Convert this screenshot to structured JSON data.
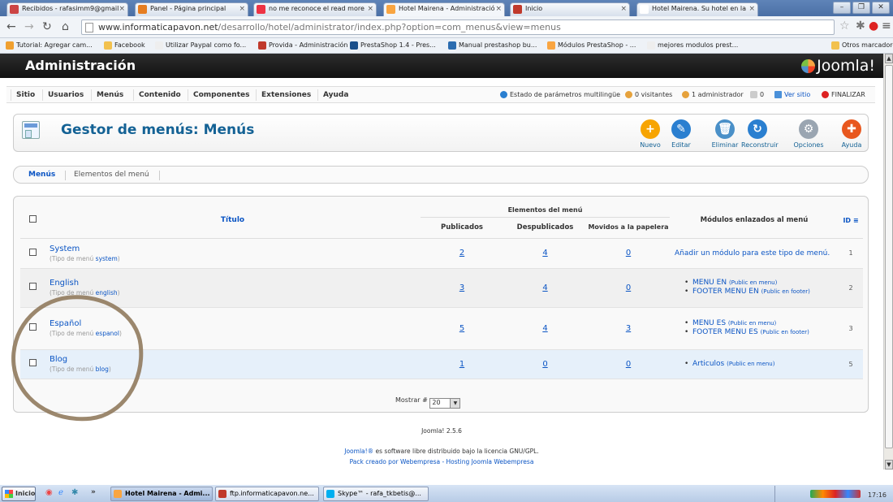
{
  "browser": {
    "tabs": [
      {
        "label": "Recibidos - rafasimm9@gmail",
        "color": "#c44"
      },
      {
        "label": "Panel - Página principal",
        "color": "#e67e22"
      },
      {
        "label": "no me reconoce el read more",
        "color": "#e34"
      },
      {
        "label": "Hotel Mairena - Administració",
        "color": "#f9a541"
      },
      {
        "label": "Inicio",
        "color": "#c0392b"
      },
      {
        "label": "Hotel Mairena. Su hotel en la",
        "color": "#fff"
      }
    ],
    "window_buttons": [
      "–",
      "❐",
      "✕"
    ],
    "url_host": "www.informaticapavon.net",
    "url_path": "/desarrollo/hotel/administrator/index.php?option=com_menus&view=menus",
    "bookmarks": [
      {
        "label": "Tutorial: Agregar cam...",
        "color": "#f0a030"
      },
      {
        "label": "Facebook",
        "color": "#f2c14e"
      },
      {
        "label": "Utilizar Paypal como fo...",
        "color": "#eee"
      },
      {
        "label": "Provida - Administración",
        "color": "#c0392b"
      },
      {
        "label": "PrestaShop 1.4 - Pres...",
        "color": "#1b4f8a"
      },
      {
        "label": "Manual prestashop bu...",
        "color": "#2b6cb0"
      },
      {
        "label": "Módulos PrestaShop - ...",
        "color": "#f9a541"
      },
      {
        "label": "mejores modulos prest...",
        "color": "#eee"
      }
    ],
    "other_bookmarks": "Otros marcadores"
  },
  "admin": {
    "title": "Administración",
    "logo": "Joomla!",
    "menu": [
      "Sitio",
      "Usuarios",
      "Menús",
      "Contenido",
      "Componentes",
      "Extensiones",
      "Ayuda"
    ],
    "status": {
      "multilingual": "Estado de parámetros multilingüe",
      "visitors": "0 visitantes",
      "admins": "1 administrador",
      "messages": "0",
      "view_site": "Ver sitio",
      "logout": "FINALIZAR"
    },
    "page_title": "Gestor de menús: Menús",
    "toolbar": [
      {
        "label": "Nuevo",
        "icon": "+",
        "color": "#f7a400"
      },
      {
        "label": "Editar",
        "icon": "✎",
        "color": "#2a7fd0"
      },
      {
        "label": "Eliminar",
        "icon": "🗑",
        "color": "#4a90c8"
      },
      {
        "label": "Reconstruir",
        "icon": "↻",
        "color": "#2a7fd0"
      },
      {
        "label": "Opciones",
        "icon": "⚙",
        "color": "#9aa5b1"
      },
      {
        "label": "Ayuda",
        "icon": "✚",
        "color": "#e8571e"
      }
    ],
    "subtabs": [
      "Menús",
      "Elementos del menú"
    ],
    "table": {
      "h_title": "Título",
      "h_group": "Elementos del menú",
      "h_pub": "Publicados",
      "h_unpub": "Despublicados",
      "h_trash": "Movidos a la papelera",
      "h_modules": "Módulos enlazados al menú",
      "h_id": "ID",
      "type_prefix": "(Tipo de menú",
      "rows": [
        {
          "title": "System",
          "type": "system",
          "pub": "2",
          "unpub": "4",
          "trash": "0",
          "modules_text": "Añadir un módulo para este tipo de menú.",
          "modules": [],
          "id": "1"
        },
        {
          "title": "English",
          "type": "english",
          "pub": "3",
          "unpub": "4",
          "trash": "0",
          "modules_text": "",
          "modules": [
            {
              "name": "MENU EN",
              "note": "(Public en menu)"
            },
            {
              "name": "FOOTER MENU EN",
              "note": "(Public en footer)"
            }
          ],
          "id": "2"
        },
        {
          "title": "Español",
          "type": "espanol",
          "pub": "5",
          "unpub": "4",
          "trash": "3",
          "modules_text": "",
          "modules": [
            {
              "name": "MENU ES",
              "note": "(Public en menu)"
            },
            {
              "name": "FOOTER MENU ES",
              "note": "(Public en footer)"
            }
          ],
          "id": "3"
        },
        {
          "title": "Blog",
          "type": "blog",
          "pub": "1",
          "unpub": "0",
          "trash": "0",
          "modules_text": "",
          "modules": [
            {
              "name": "Articulos",
              "note": "(Public en menu)"
            }
          ],
          "id": "5"
        }
      ]
    },
    "show_label": "Mostrar #",
    "show_value": "20",
    "footer": {
      "version": "Joomla! 2.5.6",
      "license_link": "Joomla!®",
      "license_text": "es software libre distribuido bajo la licencia GNU/GPL.",
      "pack": "Pack creado por Webempresa - Hosting Joomla Webempresa"
    }
  },
  "taskbar": {
    "start": "Inicio",
    "items": [
      {
        "label": "Hotel Mairena - Admi...",
        "color": "#f9a541"
      },
      {
        "label": "ftp.informaticapavon.ne...",
        "color": "#c0392b"
      },
      {
        "label": "Skype™ - rafa_tkbetis@...",
        "color": "#00aff0"
      }
    ],
    "clock": "17:16"
  }
}
